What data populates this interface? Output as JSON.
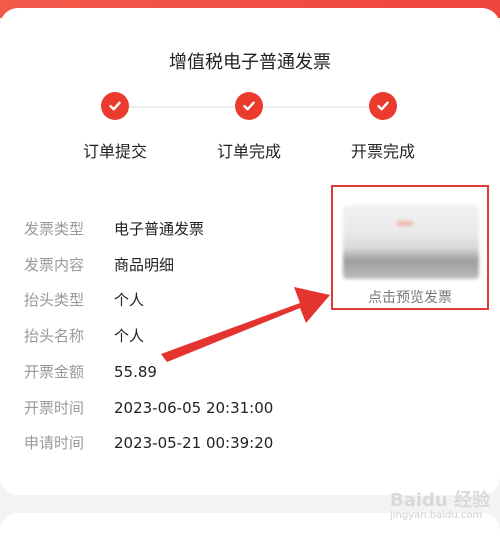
{
  "invoice": {
    "title": "增值税电子普通发票"
  },
  "steps": [
    {
      "label": "订单提交",
      "state": "done"
    },
    {
      "label": "订单完成",
      "state": "done"
    },
    {
      "label": "开票完成",
      "state": "done"
    }
  ],
  "details": [
    {
      "label": "发票类型",
      "value": "电子普通发票"
    },
    {
      "label": "发票内容",
      "value": "商品明细"
    },
    {
      "label": "抬头类型",
      "value": "个人"
    },
    {
      "label": "抬头名称",
      "value": "个人"
    },
    {
      "label": "开票金额",
      "value": "55.89"
    },
    {
      "label": "开票时间",
      "value": "2023-06-05 20:31:00"
    },
    {
      "label": "申请时间",
      "value": "2023-05-21 00:39:20"
    }
  ],
  "preview": {
    "label": "点击预览发票"
  },
  "watermark": {
    "main": "Baidu 经验",
    "sub": "jingyan.baidu.com"
  },
  "colors": {
    "accent": "#eb3b2f",
    "highlight_border": "#e23a36",
    "annotation_arrow": "#e3342f"
  }
}
